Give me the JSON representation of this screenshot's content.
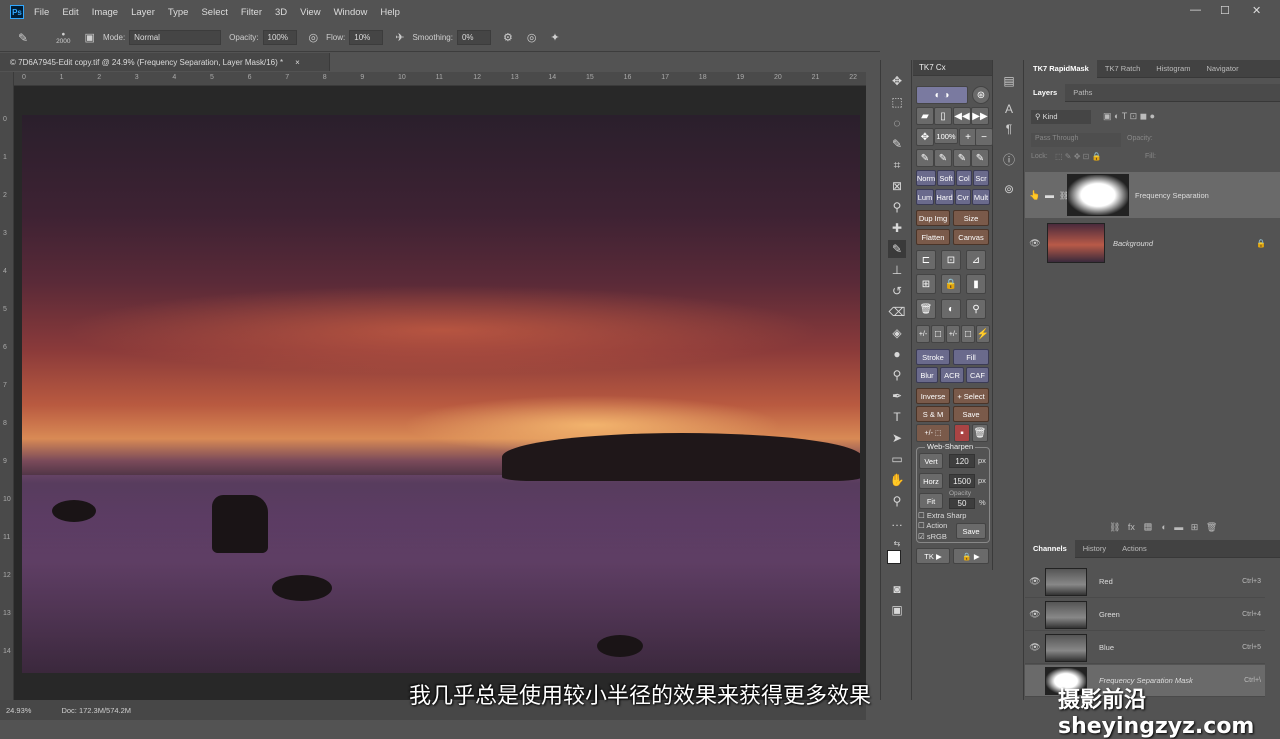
{
  "app": {
    "logo": "Ps",
    "menu": [
      "File",
      "Edit",
      "Image",
      "Layer",
      "Type",
      "Select",
      "Filter",
      "3D",
      "View",
      "Window",
      "Help"
    ],
    "window_controls": [
      "—",
      "☐",
      "✕"
    ]
  },
  "options_bar": {
    "brush_size": "2000",
    "mode_label": "Mode:",
    "mode_value": "Normal",
    "opacity_label": "Opacity:",
    "opacity_value": "100%",
    "flow_label": "Flow:",
    "flow_value": "10%",
    "smoothing_label": "Smoothing:",
    "smoothing_value": "0%"
  },
  "document": {
    "tab_title": "© 7D6A7945-Edit copy.tif @ 24.9% (Frequency Separation, Layer Mask/16) *",
    "tab_close": "×",
    "ruler_top": [
      "0",
      "1",
      "2",
      "3",
      "4",
      "5",
      "6",
      "7",
      "8",
      "9",
      "10",
      "11",
      "12",
      "13",
      "14",
      "15",
      "16",
      "17",
      "18",
      "19",
      "20",
      "21",
      "22"
    ],
    "ruler_left": [
      "0",
      "1",
      "2",
      "3",
      "4",
      "5",
      "6",
      "7",
      "8",
      "9",
      "10",
      "11",
      "12",
      "13",
      "14"
    ],
    "zoom": "24.93%",
    "doc_size": "Doc: 172.3M/574.2M"
  },
  "subtitle": "我几乎总是使用较小半径的效果来获得更多效果",
  "watermark": "摄影前沿 sheyingzyz.com",
  "tk7cx": {
    "title": "TK7 Cx",
    "zoom_btn": "100%",
    "blend_row1": [
      "Norm",
      "Soft",
      "Col",
      "Scr"
    ],
    "blend_row2": [
      "Lum",
      "Hard",
      "Cvr",
      "Mult"
    ],
    "dup_img": "Dup Img",
    "size": "Size",
    "flatten": "Flatten",
    "canvas": "Canvas",
    "stroke": "Stroke",
    "fill": "Fill",
    "blur": "Blur",
    "acr": "ACR",
    "caf": "CAF",
    "inverse": "Inverse",
    "select": "+ Select",
    "sm": "S & M",
    "save": "Save",
    "web_sharpen": {
      "title": "Web-Sharpen",
      "vert_label": "Vert",
      "vert_value": "120",
      "horz_label": "Horz",
      "horz_value": "1500",
      "unit": "px",
      "fit_label": "Fit",
      "opacity_label": "Opacity",
      "opacity_value": "50",
      "opacity_unit": "%",
      "extra_sharp": "Extra Sharp",
      "action": "Action",
      "srgb": "sRGB",
      "save": "Save"
    },
    "tk_btn": "TK ▶",
    "lock_btn": "🔒 ▶"
  },
  "layers_panel": {
    "tabs_top": [
      "TK7 RapidMask",
      "TK7 Ratch",
      "Histogram",
      "Navigator"
    ],
    "tabs": [
      "Layers",
      "Paths"
    ],
    "kind": "Kind",
    "blend": "Pass Through",
    "opacity": "Opacity:",
    "lock": "Lock:",
    "fill": "Fill:",
    "layers": [
      {
        "name": "Frequency Separation"
      },
      {
        "name": "Background"
      }
    ]
  },
  "channels_panel": {
    "tabs": [
      "Channels",
      "History",
      "Actions"
    ],
    "channels": [
      {
        "name": "Red",
        "shortcut": "Ctrl+3"
      },
      {
        "name": "Green",
        "shortcut": "Ctrl+4"
      },
      {
        "name": "Blue",
        "shortcut": "Ctrl+5"
      },
      {
        "name": "Frequency Separation Mask",
        "shortcut": "Ctrl+\\"
      }
    ]
  }
}
